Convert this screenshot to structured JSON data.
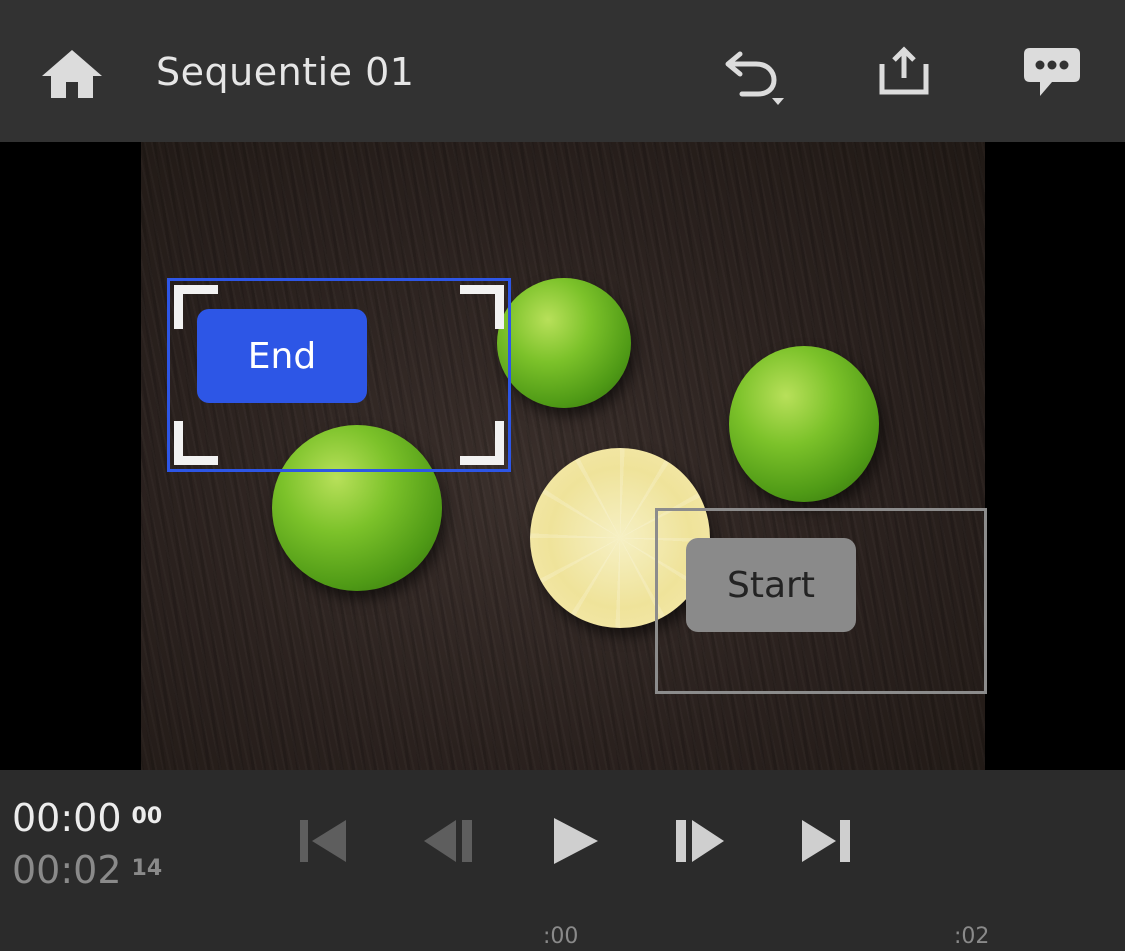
{
  "header": {
    "title": "Sequentie 01",
    "icons": [
      "home-icon",
      "undo-icon",
      "share-icon",
      "comment-icon"
    ]
  },
  "viewer": {
    "end_label": "End",
    "start_label": "Start",
    "accent_color": "#2d56e6",
    "inactive_color": "#8a8a8a"
  },
  "transport": {
    "current_time": "00:00",
    "current_frames": "00",
    "duration_time": "00:02",
    "duration_frames": "14",
    "controls": [
      "go-to-start",
      "step-back",
      "play",
      "step-forward",
      "go-to-end"
    ]
  },
  "timeline": {
    "ticks": [
      ":00",
      ":02"
    ]
  }
}
